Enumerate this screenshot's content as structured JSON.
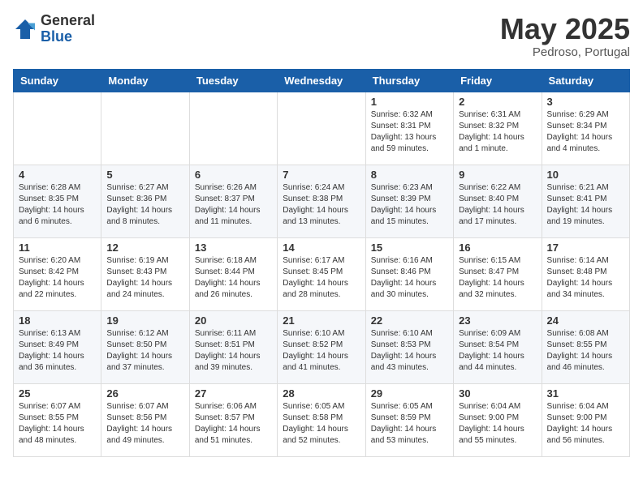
{
  "logo": {
    "general": "General",
    "blue": "Blue"
  },
  "title": "May 2025",
  "location": "Pedroso, Portugal",
  "days_of_week": [
    "Sunday",
    "Monday",
    "Tuesday",
    "Wednesday",
    "Thursday",
    "Friday",
    "Saturday"
  ],
  "weeks": [
    [
      {
        "day": "",
        "content": ""
      },
      {
        "day": "",
        "content": ""
      },
      {
        "day": "",
        "content": ""
      },
      {
        "day": "",
        "content": ""
      },
      {
        "day": "1",
        "content": "Sunrise: 6:32 AM\nSunset: 8:31 PM\nDaylight: 13 hours and 59 minutes."
      },
      {
        "day": "2",
        "content": "Sunrise: 6:31 AM\nSunset: 8:32 PM\nDaylight: 14 hours and 1 minute."
      },
      {
        "day": "3",
        "content": "Sunrise: 6:29 AM\nSunset: 8:34 PM\nDaylight: 14 hours and 4 minutes."
      }
    ],
    [
      {
        "day": "4",
        "content": "Sunrise: 6:28 AM\nSunset: 8:35 PM\nDaylight: 14 hours and 6 minutes."
      },
      {
        "day": "5",
        "content": "Sunrise: 6:27 AM\nSunset: 8:36 PM\nDaylight: 14 hours and 8 minutes."
      },
      {
        "day": "6",
        "content": "Sunrise: 6:26 AM\nSunset: 8:37 PM\nDaylight: 14 hours and 11 minutes."
      },
      {
        "day": "7",
        "content": "Sunrise: 6:24 AM\nSunset: 8:38 PM\nDaylight: 14 hours and 13 minutes."
      },
      {
        "day": "8",
        "content": "Sunrise: 6:23 AM\nSunset: 8:39 PM\nDaylight: 14 hours and 15 minutes."
      },
      {
        "day": "9",
        "content": "Sunrise: 6:22 AM\nSunset: 8:40 PM\nDaylight: 14 hours and 17 minutes."
      },
      {
        "day": "10",
        "content": "Sunrise: 6:21 AM\nSunset: 8:41 PM\nDaylight: 14 hours and 19 minutes."
      }
    ],
    [
      {
        "day": "11",
        "content": "Sunrise: 6:20 AM\nSunset: 8:42 PM\nDaylight: 14 hours and 22 minutes."
      },
      {
        "day": "12",
        "content": "Sunrise: 6:19 AM\nSunset: 8:43 PM\nDaylight: 14 hours and 24 minutes."
      },
      {
        "day": "13",
        "content": "Sunrise: 6:18 AM\nSunset: 8:44 PM\nDaylight: 14 hours and 26 minutes."
      },
      {
        "day": "14",
        "content": "Sunrise: 6:17 AM\nSunset: 8:45 PM\nDaylight: 14 hours and 28 minutes."
      },
      {
        "day": "15",
        "content": "Sunrise: 6:16 AM\nSunset: 8:46 PM\nDaylight: 14 hours and 30 minutes."
      },
      {
        "day": "16",
        "content": "Sunrise: 6:15 AM\nSunset: 8:47 PM\nDaylight: 14 hours and 32 minutes."
      },
      {
        "day": "17",
        "content": "Sunrise: 6:14 AM\nSunset: 8:48 PM\nDaylight: 14 hours and 34 minutes."
      }
    ],
    [
      {
        "day": "18",
        "content": "Sunrise: 6:13 AM\nSunset: 8:49 PM\nDaylight: 14 hours and 36 minutes."
      },
      {
        "day": "19",
        "content": "Sunrise: 6:12 AM\nSunset: 8:50 PM\nDaylight: 14 hours and 37 minutes."
      },
      {
        "day": "20",
        "content": "Sunrise: 6:11 AM\nSunset: 8:51 PM\nDaylight: 14 hours and 39 minutes."
      },
      {
        "day": "21",
        "content": "Sunrise: 6:10 AM\nSunset: 8:52 PM\nDaylight: 14 hours and 41 minutes."
      },
      {
        "day": "22",
        "content": "Sunrise: 6:10 AM\nSunset: 8:53 PM\nDaylight: 14 hours and 43 minutes."
      },
      {
        "day": "23",
        "content": "Sunrise: 6:09 AM\nSunset: 8:54 PM\nDaylight: 14 hours and 44 minutes."
      },
      {
        "day": "24",
        "content": "Sunrise: 6:08 AM\nSunset: 8:55 PM\nDaylight: 14 hours and 46 minutes."
      }
    ],
    [
      {
        "day": "25",
        "content": "Sunrise: 6:07 AM\nSunset: 8:55 PM\nDaylight: 14 hours and 48 minutes."
      },
      {
        "day": "26",
        "content": "Sunrise: 6:07 AM\nSunset: 8:56 PM\nDaylight: 14 hours and 49 minutes."
      },
      {
        "day": "27",
        "content": "Sunrise: 6:06 AM\nSunset: 8:57 PM\nDaylight: 14 hours and 51 minutes."
      },
      {
        "day": "28",
        "content": "Sunrise: 6:05 AM\nSunset: 8:58 PM\nDaylight: 14 hours and 52 minutes."
      },
      {
        "day": "29",
        "content": "Sunrise: 6:05 AM\nSunset: 8:59 PM\nDaylight: 14 hours and 53 minutes."
      },
      {
        "day": "30",
        "content": "Sunrise: 6:04 AM\nSunset: 9:00 PM\nDaylight: 14 hours and 55 minutes."
      },
      {
        "day": "31",
        "content": "Sunrise: 6:04 AM\nSunset: 9:00 PM\nDaylight: 14 hours and 56 minutes."
      }
    ]
  ]
}
